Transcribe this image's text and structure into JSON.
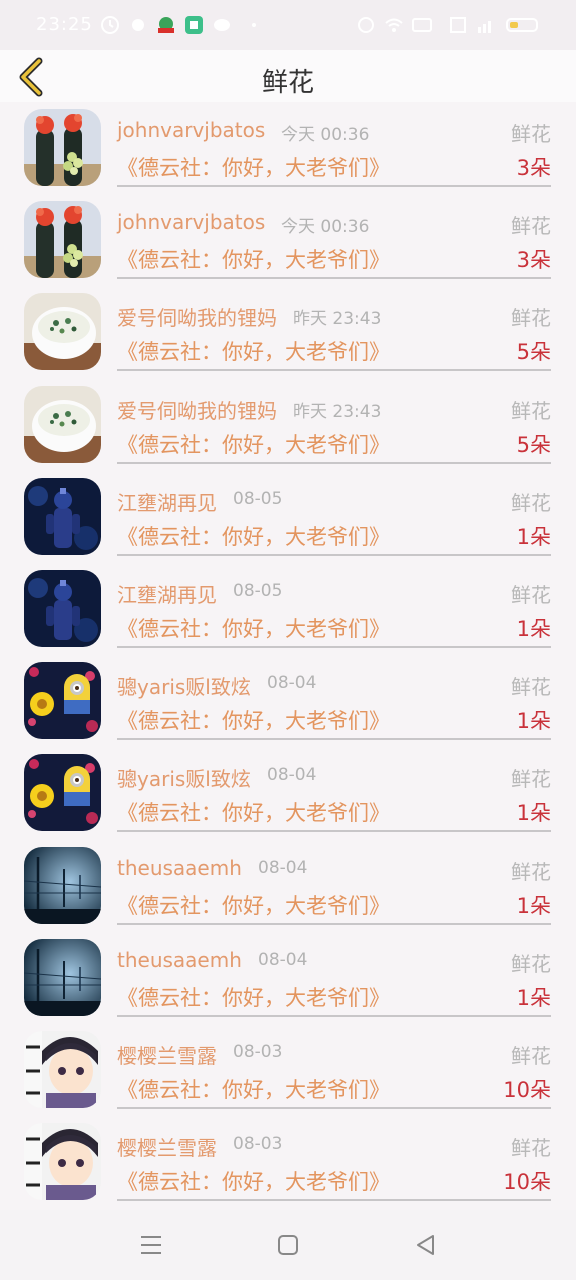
{
  "status_bar": {
    "time": "23:25"
  },
  "header": {
    "title": "鲜花"
  },
  "rows": [
    {
      "name": "johnvarvjbatos",
      "time": "今天 00:36",
      "gift": "鲜花",
      "program": "《德云社：你好，大老爷们》",
      "count": "3朵",
      "avatar": "cactus"
    },
    {
      "name": "johnvarvjbatos",
      "time": "今天 00:36",
      "gift": "鲜花",
      "program": "《德云社：你好，大老爷们》",
      "count": "3朵",
      "avatar": "cactus"
    },
    {
      "name": "爱号伺呦我的锂妈",
      "time": "昨天 23:43",
      "gift": "鲜花",
      "program": "《德云社：你好，大老爷们》",
      "count": "5朵",
      "avatar": "porridge"
    },
    {
      "name": "爱号伺呦我的锂妈",
      "time": "昨天 23:43",
      "gift": "鲜花",
      "program": "《德云社：你好，大老爷们》",
      "count": "5朵",
      "avatar": "porridge"
    },
    {
      "name": "江壅湖再见",
      "time": "08-05",
      "gift": "鲜花",
      "program": "《德云社：你好，大老爷们》",
      "count": "1朵",
      "avatar": "warrior"
    },
    {
      "name": "江壅湖再见",
      "time": "08-05",
      "gift": "鲜花",
      "program": "《德云社：你好，大老爷们》",
      "count": "1朵",
      "avatar": "warrior"
    },
    {
      "name": "骢yaris贩l致炫",
      "time": "08-04",
      "gift": "鲜花",
      "program": "《德云社：你好，大老爷们》",
      "count": "1朵",
      "avatar": "minion"
    },
    {
      "name": "骢yaris贩l致炫",
      "time": "08-04",
      "gift": "鲜花",
      "program": "《德云社：你好，大老爷们》",
      "count": "1朵",
      "avatar": "minion"
    },
    {
      "name": "theusaaemh",
      "time": "08-04",
      "gift": "鲜花",
      "program": "《德云社：你好，大老爷们》",
      "count": "1朵",
      "avatar": "fence"
    },
    {
      "name": "theusaaemh",
      "time": "08-04",
      "gift": "鲜花",
      "program": "《德云社：你好，大老爷们》",
      "count": "1朵",
      "avatar": "fence"
    },
    {
      "name": "樱樱兰雪露",
      "time": "08-03",
      "gift": "鲜花",
      "program": "《德云社：你好，大老爷们》",
      "count": "10朵",
      "avatar": "anime"
    },
    {
      "name": "樱樱兰雪露",
      "time": "08-03",
      "gift": "鲜花",
      "program": "《德云社：你好，大老爷们》",
      "count": "10朵",
      "avatar": "anime"
    }
  ],
  "nav": {
    "menu_icon": "menu-icon",
    "home_icon": "home-icon",
    "back_icon": "back-triangle-icon"
  }
}
